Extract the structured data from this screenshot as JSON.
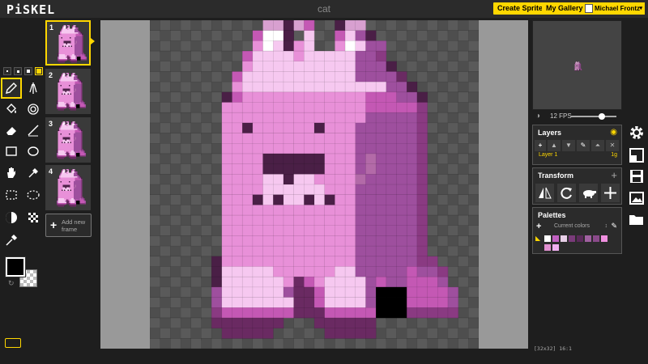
{
  "app": {
    "logo": "PiSKEL",
    "document_title": "cat"
  },
  "header": {
    "create_sprite": "Create Sprite",
    "my_gallery": "My Gallery",
    "user_name": "Michael Frontz"
  },
  "frames": [
    {
      "number": "1"
    },
    {
      "number": "2"
    },
    {
      "number": "3"
    },
    {
      "number": "4"
    }
  ],
  "add_frame_label": "Add new frame",
  "preview": {
    "fps_label": "12 FPS",
    "fps_value": 12
  },
  "layers": {
    "title": "Layers",
    "layer_name": "Layer 1",
    "layer_count": "1g"
  },
  "transform": {
    "title": "Transform"
  },
  "palettes": {
    "title": "Palettes",
    "current": "Current colors",
    "colors": [
      "#ffffff",
      "#c060c0",
      "#e8d0e8",
      "#7a3b7a",
      "#5a2a5a",
      "#a060a0",
      "#8a4a8a",
      "#f090e0",
      "#e090d0",
      "#f0b0f0"
    ]
  },
  "status": "[32x32] 16:1",
  "colors": {
    "accent": "#ffd700"
  },
  "icons": [
    "pen-icon",
    "vertical-mirror-pen-icon",
    "paint-bucket-icon",
    "paint-same-color-icon",
    "eraser-icon",
    "stroke-icon",
    "rectangle-icon",
    "circle-icon",
    "move-icon",
    "shape-select-icon",
    "rect-select-icon",
    "lasso-select-icon",
    "lighten-icon",
    "dithering-icon",
    "color-picker-icon",
    "settings-icon",
    "resize-icon",
    "save-icon",
    "import-icon",
    "open-folder-icon"
  ],
  "sprite": {
    "palette": {
      ".": "",
      "a": "#ffffff",
      "b": "#f6c8f0",
      "c": "#e890d8",
      "d": "#c458b4",
      "e": "#9e4f9e",
      "f": "#8a3a82",
      "g": "#6a2a62",
      "h": "#4a1f46",
      "k": "#000000",
      "m": "#b36aa8",
      "n": "#d8a0d0"
    },
    "rows": [
      "...........nnhnd..hnn...........",
      "..........daah.b..dbeh..........",
      "..........cabhcb..cabee.........",
      ".........dbbbbcbbbbbeef.........",
      ".........cbbbbbbbbbbeeeh........",
      "........dbbbbbbbbbbbeeeeg.......",
      "........cbbbbbbbbbbbbbbeeh......",
      ".......hdccccccccccccdddeeh......",
      ".......ccccccccccccccdddddf......",
      ".......cccccccccccccceeeeef......",
      ".......cchcccccchccceeeeeef......",
      ".......ccccccccccccceeeeeef......",
      ".......ccccccccccccceeeeeef......",
      ".......cccchhhhhhcccemeeeef......",
      ".......cccchhhhhhcccemeeeef......",
      ".......ccccbbhbbccccmeeeeef......",
      ".......ccccbbbbbbccceeeeeef......",
      ".......ccchbhbbhbhcceeeeeef......",
      ".......ccccccccccccceeeeeef......",
      ".......ccccccccccccceeeeeef......",
      ".......ccccccccccccceeeeeef......",
      ".......ccccccccccccceeeeeef......",
      ".......ccccccccccccceeeeeef......",
      "......hccccccccccccceeeeeeff.....",
      "......hbbbbbccccccbbeeeeedeef....",
      "......hbbbbbbcgdcbbbbedeeddde....",
      "......ebbbbbbeggdbbbbekkkdddde...",
      "......ebbbbbbbggdbbbbekkkdddde...",
      "......fdddddddgggdddddkkkfffff...",
      "......ggggggg...gggggg..........",
      ".......ggggg.....ggggg..........",
      "................................"
    ]
  }
}
